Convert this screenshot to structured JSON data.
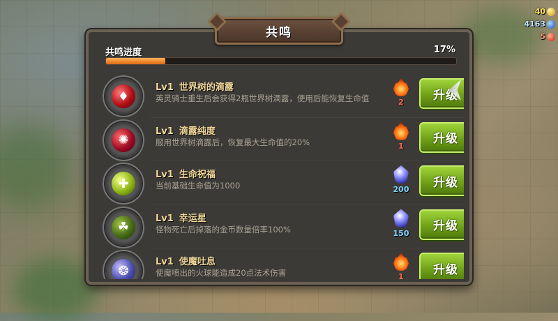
{
  "resources": [
    {
      "value": "40",
      "icon": "gold-coin-icon"
    },
    {
      "value": "4163",
      "icon": "blue-gem-icon"
    },
    {
      "value": "5",
      "icon": "red-gem-icon"
    }
  ],
  "panel": {
    "title": "共鸣",
    "progress": {
      "label": "共鸣进度",
      "percent_text": "17%",
      "fraction": 0.17
    }
  },
  "items": [
    {
      "level": "Lv1",
      "name": "世界树的滴露",
      "desc": "英灵骑士重生后会获得2瓶世界树滴露，使用后能恢复生命值",
      "icon": "red-dewdrop-icon",
      "cost_type": "fire-gem-icon",
      "cost": "2",
      "button": "升级"
    },
    {
      "level": "Lv1",
      "name": "滴露纯度",
      "desc": "服用世界树滴露后，恢复最大生命值的20%",
      "icon": "crimson-orb-icon",
      "cost_type": "fire-gem-icon",
      "cost": "1",
      "button": "升级"
    },
    {
      "level": "Lv1",
      "name": "生命祝福",
      "desc": "当前基础生命值为1000",
      "icon": "green-cross-icon",
      "cost_type": "blue-crystal-icon",
      "cost": "200",
      "button": "升级"
    },
    {
      "level": "Lv1",
      "name": "幸运星",
      "desc": "怪物死亡后掉落的金币数量倍率100%",
      "icon": "clover-icon",
      "cost_type": "blue-crystal-icon",
      "cost": "150",
      "button": "升级"
    },
    {
      "level": "Lv1",
      "name": "使魔吐息",
      "desc": "使魔喷出的火球能造成20点法术伤害",
      "icon": "purple-sphere-icon",
      "cost_type": "fire-gem-icon",
      "cost": "1",
      "button": "升级"
    }
  ]
}
